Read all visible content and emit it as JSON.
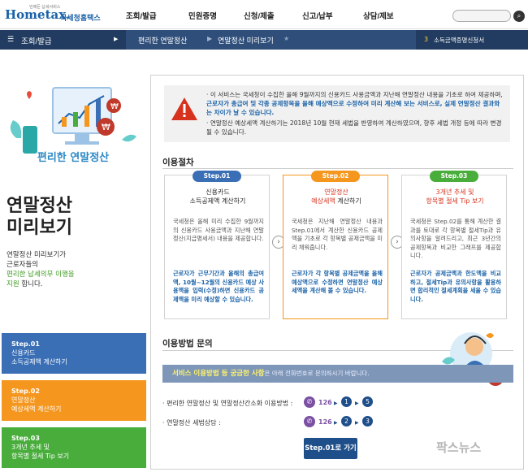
{
  "header": {
    "logo_brand": "Hometax.",
    "logo_tagline": "언제든 납세서비스",
    "logo_kr": "국세청홈택스",
    "menu": [
      "조회/발급",
      "민원증명",
      "신청/제출",
      "신고/납부",
      "상담/제보"
    ]
  },
  "navbar": {
    "current": "조회/발급",
    "crumbs": [
      "편리한 연말정산",
      "연말정산 미리보기"
    ],
    "right_num": "3",
    "right_text": "소득금액증명신청서"
  },
  "left": {
    "hero_title": "편리한 연말정산",
    "big_title_1": "연말정산",
    "big_title_2": "미리보기",
    "desc_1": "연말정산 미리보기가",
    "desc_2": "근로자들의",
    "desc_3": "편리한 납세의무 이행을",
    "desc_4": "지원",
    "desc_5": " 합니다.",
    "steps": [
      {
        "title": "Step.01",
        "line1": "신용카드",
        "line2": "소득공제액 계산하기"
      },
      {
        "title": "Step.02",
        "line1": "연말정산",
        "line2": "예상세액 계산하기"
      },
      {
        "title": "Step.03",
        "line1": "3개년 추세 및",
        "line2": "항목별 절세 Tip 보기"
      }
    ]
  },
  "notice": {
    "item1_a": "이 서비스는 국세청이 수집한 올해 9월까지의 신용카드 사용금액과 지난해 연말정산 내용을 기초로 하여 제공하며, ",
    "item1_b": "근로자가 총급여 및 각종 공제항목을 올해 예상액으로 수정하여 미리 계산해 보는 서비스로, 실제 연말정산 결과와는 차이가 날 수 있습니다.",
    "item2": "연말정산 예상세액 계산하기는 2018년 10월 현재 세법을 반영하여 계산하였으며, 향후 세법 개정 등에 따라 변경될 수 있습니다."
  },
  "procedure": {
    "title": "이용절차",
    "boxes": [
      {
        "pill": "Step.01",
        "head1": "신용카드",
        "head2": "소득공제액 계산하기",
        "body": "국세청은 올해 미리 수집한 9월까지의 신용카드 사용금액과 지난해 연말정산(지급명세서) 내용을 제공합니다.",
        "blue": "근로자가 근무기간과 올해의 총급여액, 10월~12월의 신용카드 예상 사용액을 입력(수정)하면 신용카드 공제액을 미리 예상할 수 있습니다."
      },
      {
        "pill": "Step.02",
        "head1": "연말정산",
        "head2a": "예상세액",
        "head2b": " 계산하기",
        "body": "국세청은 지난해 연말정산 내용과 Step.01에서 계산한 신용카드 공제액을 기초로 각 항목별 공제금액을 미리 채워줍니다.",
        "blue": "근로자가 각 항목별 공제금액을 올해예상액으로 수정하면 연말정산 예상세액을 계산해 볼 수 있습니다."
      },
      {
        "pill": "Step.03",
        "head1": "3개년 추세 및",
        "head2": "항목별 절세 Tip 보기",
        "body": "국세청은 Step.02를 통해 계산한 결과를 토대로 각 항목별 절세Tip과 유의사항을 알려드리고, 최근 3년간의 공제항목과 비교한 그래프를 제공합니다.",
        "blue": "근로자가 공제금액과 한도액을 비교하고, 절세Tip과 유의사항을 활용하면 합리적인 절세계획을 세울 수 있습니다."
      }
    ],
    "arrow": "›"
  },
  "inquiry": {
    "title": "이용방법 문의",
    "banner_a": "서비스 이용방법 등 궁금한 사항",
    "banner_b": "은 아래 전화번호로 문의하시기 바랍니다.",
    "row1_label": "· 편리한 연말정산 및 연말정산간소화 이용방법 :",
    "row2_label": "· 연말정산 세법상담 :",
    "phone": "126",
    "row1_steps": [
      "1",
      "5"
    ],
    "row2_steps": [
      "2",
      "3"
    ],
    "go_button": "Step.01로 가기"
  },
  "watermark": "팍스뉴스",
  "colors": {
    "navy": "#2f4f7a",
    "step1": "#3a6fb6",
    "step2": "#f5961e",
    "step3": "#49ad3c",
    "accent_blue": "#1a62a8"
  }
}
